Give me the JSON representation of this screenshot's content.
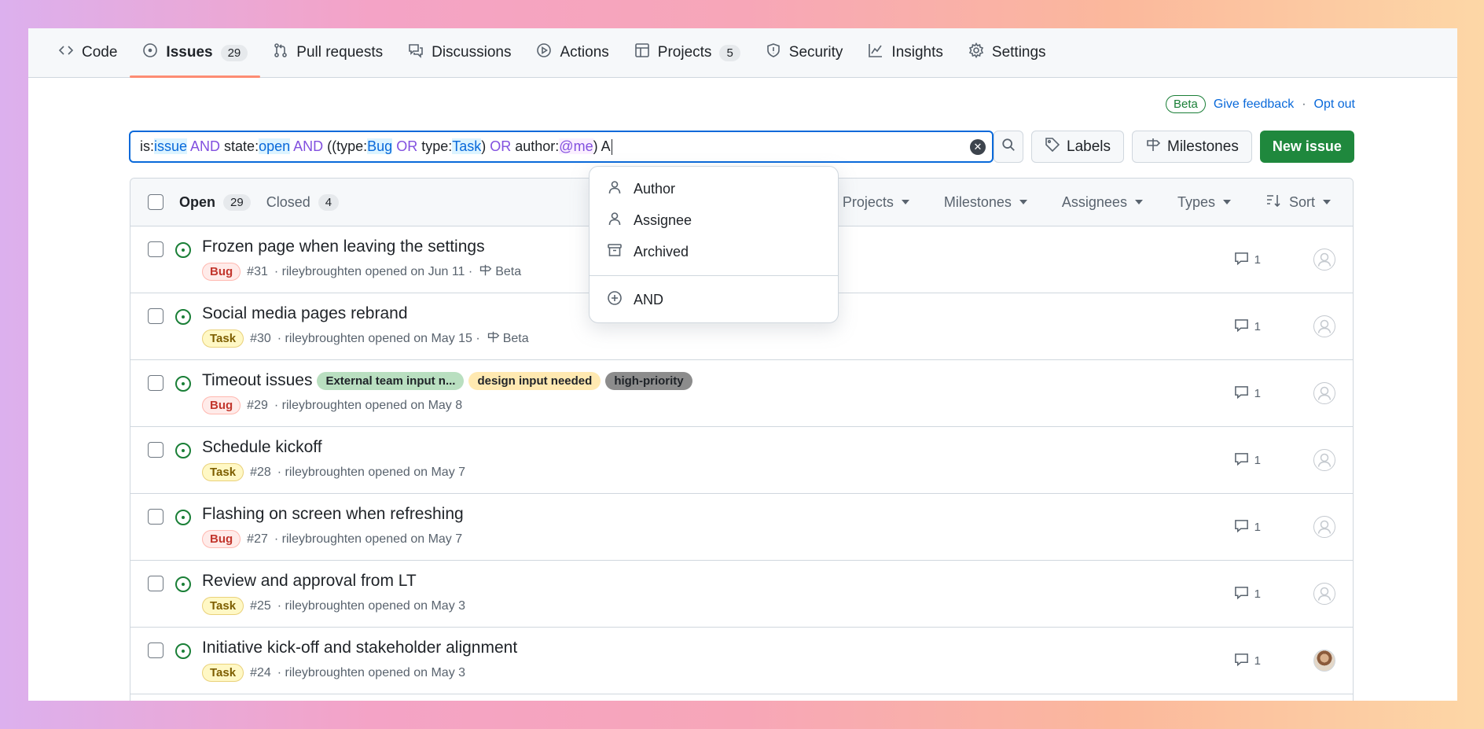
{
  "nav": {
    "items": [
      {
        "label": "Code",
        "icon": "code-icon"
      },
      {
        "label": "Issues",
        "icon": "issue-opened-icon",
        "count": "29",
        "active": true
      },
      {
        "label": "Pull requests",
        "icon": "git-pull-request-icon"
      },
      {
        "label": "Discussions",
        "icon": "comment-discussion-icon"
      },
      {
        "label": "Actions",
        "icon": "play-icon"
      },
      {
        "label": "Projects",
        "icon": "table-icon",
        "count": "5"
      },
      {
        "label": "Security",
        "icon": "shield-icon"
      },
      {
        "label": "Insights",
        "icon": "graph-icon"
      },
      {
        "label": "Settings",
        "icon": "gear-icon"
      }
    ]
  },
  "beta": {
    "badge": "Beta",
    "feedback": "Give feedback",
    "separator": "·",
    "opt_out": "Opt out"
  },
  "search": {
    "query_tokens": [
      {
        "t": "is:",
        "k": "plain"
      },
      {
        "t": "issue",
        "k": "val"
      },
      {
        "t": " AND ",
        "k": "op"
      },
      {
        "t": "state:",
        "k": "plain"
      },
      {
        "t": "open",
        "k": "val"
      },
      {
        "t": " AND ",
        "k": "op"
      },
      {
        "t": "((type:",
        "k": "plain"
      },
      {
        "t": "Bug",
        "k": "val"
      },
      {
        "t": " OR ",
        "k": "op"
      },
      {
        "t": "type:",
        "k": "plain"
      },
      {
        "t": "Task",
        "k": "val"
      },
      {
        "t": ") ",
        "k": "plain"
      },
      {
        "t": "OR",
        "k": "op"
      },
      {
        "t": " author:",
        "k": "plain"
      },
      {
        "t": "@me",
        "k": "me"
      },
      {
        "t": ") A",
        "k": "plain"
      }
    ],
    "clear_icon": "x-circle-fill-icon",
    "search_icon": "search-icon"
  },
  "toolbar": {
    "labels": "Labels",
    "milestones": "Milestones",
    "new_issue": "New issue"
  },
  "list_header": {
    "open_label": "Open",
    "open_count": "29",
    "closed_label": "Closed",
    "closed_count": "4",
    "projects": "Projects",
    "milestones": "Milestones",
    "assignees": "Assignees",
    "types": "Types",
    "sort": "Sort"
  },
  "dropdown": {
    "items": [
      {
        "label": "Author",
        "icon": "person-icon"
      },
      {
        "label": "Assignee",
        "icon": "person-icon"
      },
      {
        "label": "Archived",
        "icon": "archive-icon"
      }
    ],
    "and_item": {
      "label": "AND",
      "icon": "plus-circle-icon"
    }
  },
  "issues": [
    {
      "title": "Frozen page when leaving the settings",
      "type": "Bug",
      "number": "#31",
      "meta": "· rileybroughten opened on Jun 11 ·",
      "milestone": "Beta",
      "labels": [],
      "comments": "1",
      "avatar": "empty"
    },
    {
      "title": "Social media pages rebrand",
      "type": "Task",
      "number": "#30",
      "meta": "· rileybroughten opened on May 15 ·",
      "milestone": "Beta",
      "labels": [],
      "comments": "1",
      "avatar": "empty"
    },
    {
      "title": "Timeout issues",
      "type": "Bug",
      "number": "#29",
      "meta": "· rileybroughten opened on May 8",
      "milestone": "",
      "labels": [
        "External team input n...",
        "design input needed",
        "high-priority"
      ],
      "comments": "1",
      "avatar": "empty"
    },
    {
      "title": "Schedule kickoff",
      "type": "Task",
      "number": "#28",
      "meta": "· rileybroughten opened on May 7",
      "milestone": "",
      "labels": [],
      "comments": "1",
      "avatar": "empty"
    },
    {
      "title": "Flashing on screen when refreshing",
      "type": "Bug",
      "number": "#27",
      "meta": "· rileybroughten opened on May 7",
      "milestone": "",
      "labels": [],
      "comments": "1",
      "avatar": "empty"
    },
    {
      "title": "Review and approval from LT",
      "type": "Task",
      "number": "#25",
      "meta": "· rileybroughten opened on May 3",
      "milestone": "",
      "labels": [],
      "comments": "1",
      "avatar": "empty"
    },
    {
      "title": "Initiative kick-off and stakeholder alignment",
      "type": "Task",
      "number": "#24",
      "meta": "· rileybroughten opened on May 3",
      "milestone": "",
      "labels": [],
      "comments": "1",
      "avatar": "photo"
    }
  ]
}
